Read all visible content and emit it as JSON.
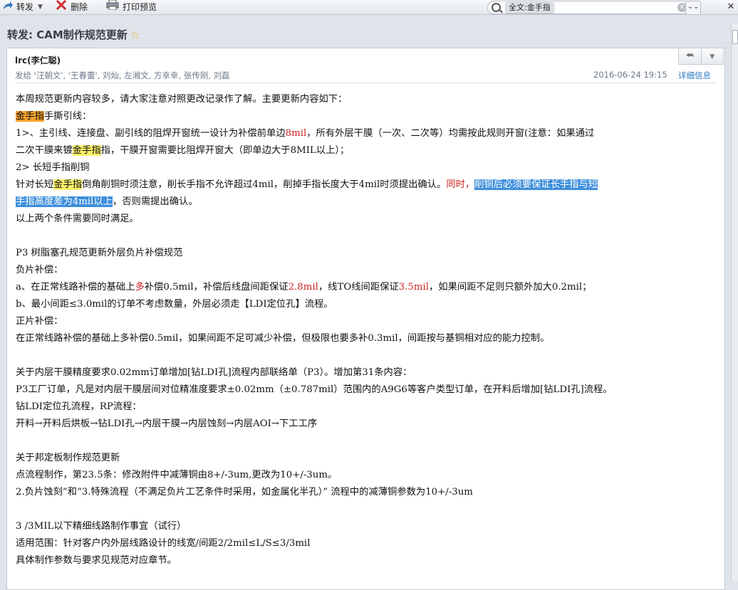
{
  "toolbar": {
    "forward_label": "转发",
    "delete_label": "删除",
    "print_label": "打印预览",
    "search_tag": "全文:金手指"
  },
  "email": {
    "subject": "转发: CAM制作规范更新",
    "sender": "lrc(李仁聪)",
    "recipients": "发给 '汪朝文', '王春蕾', 刘灿, 左湘文, 方幸幸, 张传刚, 刘磊",
    "date": "2016-06-24 19:15",
    "details_label": "详细信息"
  },
  "body": {
    "l1": "本周规范更新内容较多，请大家注意对照更改记录作了解。主要更新内容如下：",
    "l2a": "金手指",
    "l2b": "手撕引线：",
    "l3a": "1>、主引线、连接盘、副引线的阻焊开窗统一设计为补偿前单边",
    "l3b": "8mil",
    "l3c": "，所有外层干膜（一次、二次等）均需按此规则开窗(注意：如果通过",
    "l4a": "二次干膜来镀",
    "l4b": "金手指",
    "l4c": "指，干膜开窗需要比阻焊开窗大（即单边大于8MIL以上）；",
    "l5": "2> 长短手指削铜",
    "l6a": "针对长短",
    "l6b": "金手指",
    "l6c": "倒角削铜时须注意，削长手指不允许超过4mil，削掉手指长度大于4mil时须提出确认。",
    "l6d": "同时，",
    "l6e": "削铜后必须要保证长手指与短",
    "l7a": "手指高度差为4mil以上",
    "l7b": "，否则需提出确认。",
    "l8": "以上两个条件需要同时满足。",
    "l10": "P3 树脂塞孔规范更新外层负片补偿规范",
    "l11": "负片补偿：",
    "l12a": "a、在正常线路补偿的基础上",
    "l12b": "多",
    "l12c": "补偿0.5mil，补偿后线盘间距保证",
    "l12d": "2.8mil",
    "l12e": "，线TO线间距保证",
    "l12f": "3.5mil",
    "l12g": "，如果间距不足则只额外加大0.2mil；",
    "l13": "b、最小间距≤3.0mil的订单不考虑数量，外层必须走【LDI定位孔】流程。",
    "l14": "正片补偿：",
    "l15": "在正常线路补偿的基础上多补偿0.5mil，如果间距不足可减少补偿，但极限也要多补0.3mil，间距按与基铜相对应的能力控制。",
    "l17": "关于内层干膜精度要求0.02mm订单增加[钻LDI孔]流程内部联络单（P3）。增加第31条内容：",
    "l18": "P3工厂订单，凡是对内层干膜层间对位精准度要求±0.02mm（±0.787mil）范围内的A9G6等客户类型订单，在开料后增加[钻LDI孔]流程。",
    "l19": "钻LDI定位孔流程，RP流程：",
    "l20": "开料→开料后烘板→钻LDI孔→内层干膜→内层蚀刻→内层AOI→下工工序",
    "l22": "关于邦定板制作规范更新",
    "l23": "点流程制作，第23.5条：修改附件中减薄铜由8+/-3um,更改为10+/-3um。",
    "l24": "2.负片蚀刻”和“3.特殊流程（不满足负片工艺条件时采用，如金属化半孔）” 流程中的减薄铜参数为10+/-3um",
    "l26": "3 /3MIL以下精细线路制作事宜（试行）",
    "l27": "适用范围：针对客户内外层线路设计的线宽/间距2/2mil≤L/S≤3/3mil",
    "l28": "具体制作参数与要求见规范对应章节。"
  }
}
